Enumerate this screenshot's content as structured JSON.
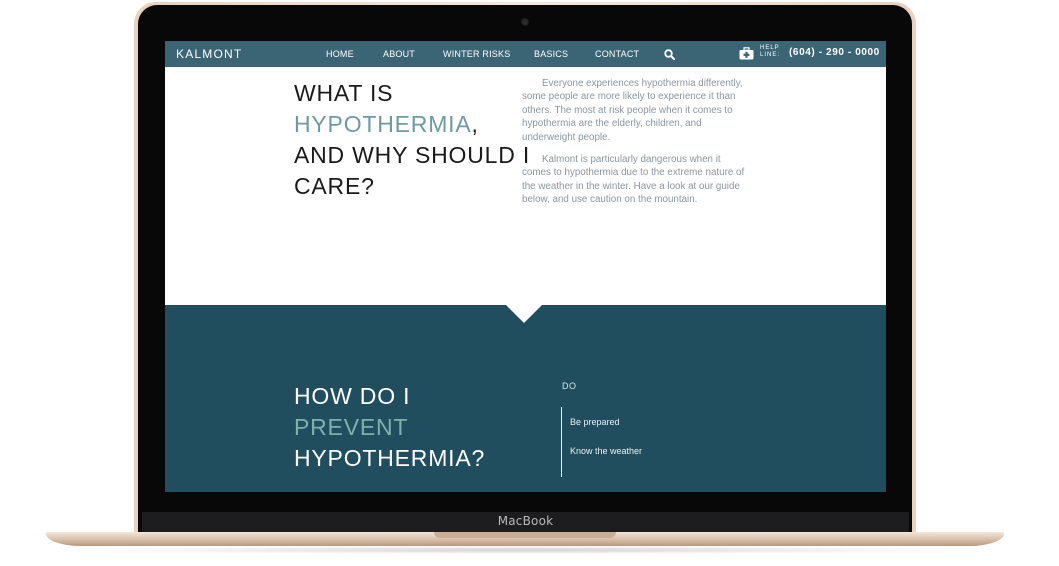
{
  "device": {
    "brand_label": "MacBook"
  },
  "nav": {
    "logo": "KALMONT",
    "items": [
      {
        "label": "HOME"
      },
      {
        "label": "ABOUT"
      },
      {
        "label": "WINTER RISKS"
      },
      {
        "label": "BASICS"
      },
      {
        "label": "CONTACT"
      }
    ],
    "search_icon": "search-icon",
    "help_icon": "first-aid-kit-icon",
    "help_label": "HELP LINE:",
    "help_phone": "(604) - 290 - 0000"
  },
  "section_intro": {
    "title_line1": "WHAT IS",
    "title_accent": "HYPOTHERMIA",
    "title_comma": ",",
    "title_line3": "AND WHY SHOULD I",
    "title_line4": "CARE?",
    "paragraph1": "Everyone experiences hypothermia differently, some people are more likely to experience it than others. The most at risk people when it comes to hypothermia are the elderly, children, and underweight people.",
    "paragraph2": "Kalmont is particularly dangerous when it comes to hypothermia due to the extreme nature of the weather in the winter. Have a look at our guide below, and use caution on the mountain."
  },
  "section_prevent": {
    "title_line1": "HOW DO I",
    "title_accent": "PREVENT",
    "title_line3": "HYPOTHERMIA?",
    "do_label": "DO",
    "do_items": [
      {
        "label": "Be prepared"
      },
      {
        "label": "Know the weather"
      }
    ]
  },
  "colors": {
    "nav_background": "#3b6574",
    "section_dark": "#214e5e",
    "accent": "#6e9aa3",
    "laptop_gold": "#e6d2be"
  }
}
